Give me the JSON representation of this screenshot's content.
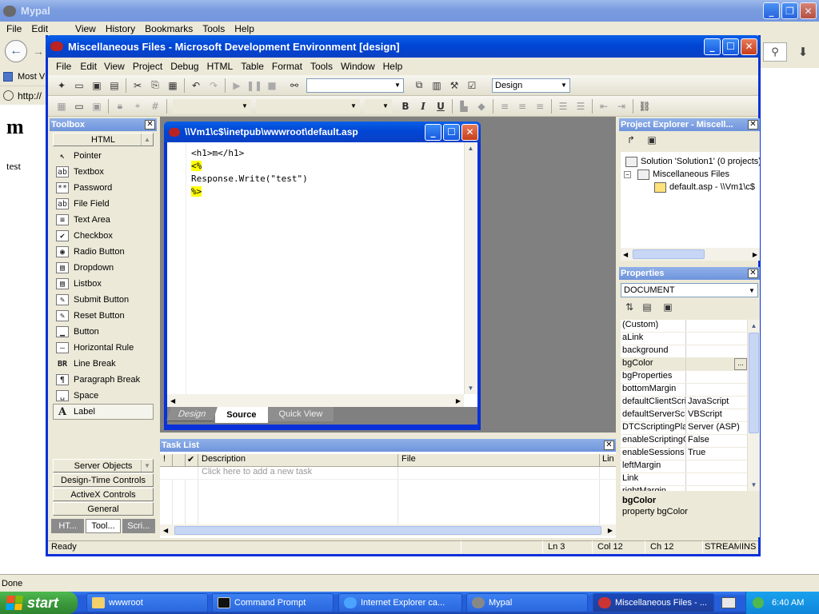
{
  "ie": {
    "title": "Mypal",
    "menu": [
      "File",
      "Edit",
      "View",
      "History",
      "Bookmarks",
      "Tools",
      "Help"
    ],
    "bookmark_label": "Most V",
    "address_text": "http://",
    "page_heading": "m",
    "page_text": "test",
    "status": "Done"
  },
  "vs": {
    "title": "Miscellaneous Files - Microsoft Development Environment [design]",
    "menu": [
      "File",
      "Edit",
      "View",
      "Project",
      "Debug",
      "HTML",
      "Table",
      "Format",
      "Tools",
      "Window",
      "Help"
    ],
    "mode_combo": "Design",
    "format_buttons": {
      "bold": "B",
      "italic": "I",
      "underline": "U"
    }
  },
  "toolbox": {
    "title": "Toolbox",
    "section": "HTML",
    "items": [
      {
        "label": "Pointer",
        "icon": "pointer-icon",
        "glyph": "↖"
      },
      {
        "label": "Textbox",
        "icon": "textbox-icon",
        "glyph": "ab"
      },
      {
        "label": "Password",
        "icon": "password-icon",
        "glyph": "**"
      },
      {
        "label": "File Field",
        "icon": "file-field-icon",
        "glyph": "ab"
      },
      {
        "label": "Text Area",
        "icon": "text-area-icon",
        "glyph": "≡"
      },
      {
        "label": "Checkbox",
        "icon": "checkbox-icon",
        "glyph": "✔"
      },
      {
        "label": "Radio Button",
        "icon": "radio-button-icon",
        "glyph": "◉"
      },
      {
        "label": "Dropdown",
        "icon": "dropdown-icon",
        "glyph": "▤"
      },
      {
        "label": "Listbox",
        "icon": "listbox-icon",
        "glyph": "▤"
      },
      {
        "label": "Submit Button",
        "icon": "submit-button-icon",
        "glyph": "✎"
      },
      {
        "label": "Reset Button",
        "icon": "reset-button-icon",
        "glyph": "✎"
      },
      {
        "label": "Button",
        "icon": "button-icon",
        "glyph": "▁"
      },
      {
        "label": "Horizontal Rule",
        "icon": "horizontal-rule-icon",
        "glyph": "—"
      },
      {
        "label": "Line Break",
        "icon": "line-break-icon",
        "glyph": "BR"
      },
      {
        "label": "Paragraph Break",
        "icon": "paragraph-break-icon",
        "glyph": "¶"
      },
      {
        "label": "Space",
        "icon": "space-icon",
        "glyph": "␣"
      },
      {
        "label": "Label",
        "icon": "label-icon",
        "glyph": "A"
      }
    ],
    "bottom_tabs": [
      "Server Objects",
      "Design-Time Controls",
      "ActiveX Controls",
      "General"
    ],
    "panel_tabs": [
      "HT...",
      "Tool...",
      "Scri..."
    ]
  },
  "editor": {
    "title": "\\\\Vm1\\c$\\inetpub\\wwwroot\\default.asp",
    "lines": [
      {
        "text": "<h1>m</h1>",
        "hl": false
      },
      {
        "text": "<%",
        "hl": true
      },
      {
        "text": "Response.Write(\"test\")",
        "hl": false
      },
      {
        "text": "%>",
        "hl": true
      }
    ],
    "tabs": [
      "Design",
      "Source",
      "Quick View"
    ]
  },
  "tasklist": {
    "title": "Task List",
    "columns": [
      "!",
      "✔",
      "Description",
      "File",
      "Lin"
    ],
    "placeholder": "Click here to add a new task"
  },
  "project_explorer": {
    "title": "Project Explorer - Miscell...",
    "solution": "Solution 'Solution1' (0 projects)",
    "folder": "Miscellaneous Files",
    "file": "default.asp - \\\\Vm1\\c$"
  },
  "properties": {
    "title": "Properties",
    "object": "DOCUMENT",
    "rows": [
      {
        "name": "(Custom)",
        "value": ""
      },
      {
        "name": "aLink",
        "value": ""
      },
      {
        "name": "background",
        "value": ""
      },
      {
        "name": "bgColor",
        "value": ""
      },
      {
        "name": "bgProperties",
        "value": ""
      },
      {
        "name": "bottomMargin",
        "value": ""
      },
      {
        "name": "defaultClientScrip",
        "value": "JavaScript"
      },
      {
        "name": "defaultServerScr",
        "value": "VBScript"
      },
      {
        "name": "DTCScriptingPlatl",
        "value": "Server (ASP)"
      },
      {
        "name": "enableScriptingO",
        "value": "False"
      },
      {
        "name": "enableSessions",
        "value": "True"
      },
      {
        "name": "leftMargin",
        "value": ""
      },
      {
        "name": "Link",
        "value": ""
      },
      {
        "name": "rightMargin",
        "value": ""
      }
    ],
    "ellipsis": "...",
    "desc_title": "bgColor",
    "desc_text": "property bgColor"
  },
  "statusbar": {
    "ready": "Ready",
    "ln": "Ln 3",
    "col": "Col 12",
    "ch": "Ch 12",
    "stream": "STREAM",
    "ins": "INS"
  },
  "taskbar": {
    "start": "start",
    "items": [
      "wwwroot",
      "Command Prompt",
      "Internet Explorer ca...",
      "Mypal",
      "Miscellaneous Files - ..."
    ],
    "clock": "6:40 AM"
  },
  "colors": {
    "xp_blue": "#0046d5",
    "asp_highlight": "#ffff00",
    "taskbar": "#245edb",
    "start": "#3c9a3c"
  }
}
